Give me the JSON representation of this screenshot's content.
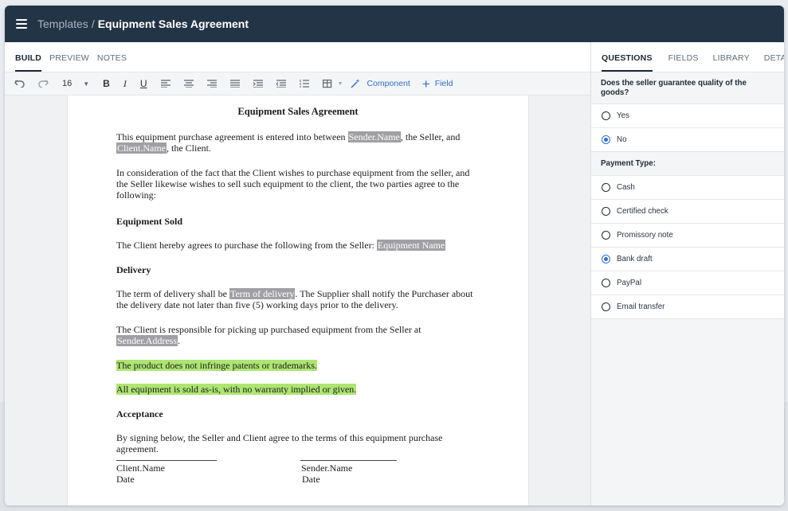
{
  "header": {
    "breadcrumb_parent": "Templates",
    "breadcrumb_separator": "/",
    "title": "Equipment Sales Agreement",
    "menu_icon": "hamburger-icon"
  },
  "editor_tabs": [
    {
      "label": "BUILD",
      "active": true
    },
    {
      "label": "PREVIEW",
      "active": false
    },
    {
      "label": "NOTES",
      "active": false
    }
  ],
  "toolbar": {
    "font_size": "16",
    "icons": [
      "undo-icon",
      "redo-icon",
      "font-size-dropdown",
      "bold-icon",
      "italic-icon",
      "underline-icon",
      "align-left-icon",
      "align-center-icon",
      "align-right-icon",
      "justify-icon",
      "indent-icon",
      "outdent-icon",
      "ordered-list-icon",
      "table-icon",
      "magic-wand-icon"
    ],
    "bold": "B",
    "italic": "I",
    "underline": "U",
    "component_label": "Component",
    "field_label": "Field"
  },
  "document": {
    "title": "Equipment Sales Agreement",
    "p1_before": "This equipment purchase agreement is entered into between ",
    "p1_var1": "Sender.Name",
    "p1_mid": ", the Seller, and",
    "p1_var2": "Client.Name",
    "p1_after": ", the Client.",
    "p2": "In consideration of the fact that the Client wishes to purchase equipment from the seller, and the Seller likewise wishes to sell such equipment to the client, the two parties agree to the following:",
    "h_sold": "Equipment Sold",
    "p3_before": "The Client hereby agrees to purchase the following from the Seller: ",
    "p3_var": "Equipment Name",
    "h_delivery": "Delivery",
    "p4_before": "The term of delivery shall be ",
    "p4_var": "Term of delivery",
    "p4_after": ". The Supplier shall notify the Purchaser about the delivery date not later than five (5) working days prior to the delivery.",
    "p5_before": "The Client is responsible for picking up purchased equipment from the Seller at",
    "p5_var": "Sender.Address",
    "p5_after": ".",
    "hl1": "The product does not infringe patents or trademarks.",
    "hl2": "All equipment is sold as-is, with no warranty implied or given.",
    "h_acceptance": "Acceptance",
    "p6": "By signing below, the Seller and Client agree to the terms of this equipment purchase agreement.",
    "sig_client_name": "Client.Name",
    "sig_client_date": "Date",
    "sig_sender_name": "Sender.Name",
    "sig_sender_date": "Date",
    "colors": {
      "variable_bg": "#a0a0a4",
      "highlight_bg": "#aee572"
    }
  },
  "sidebar_tabs": [
    {
      "label": "QUESTIONS",
      "active": true
    },
    {
      "label": "FIELDS",
      "active": false
    },
    {
      "label": "LIBRARY",
      "active": false
    },
    {
      "label": "DETAILS",
      "active": false
    }
  ],
  "questions": [
    {
      "label": "Does the seller guarantee quality of the goods?",
      "options": [
        {
          "label": "Yes",
          "selected": false
        },
        {
          "label": "No",
          "selected": true
        }
      ]
    },
    {
      "label": "Payment Type:",
      "options": [
        {
          "label": "Cash",
          "selected": false
        },
        {
          "label": "Certified check",
          "selected": false
        },
        {
          "label": "Promissory note",
          "selected": false
        },
        {
          "label": "Bank draft",
          "selected": true
        },
        {
          "label": "PayPal",
          "selected": false
        },
        {
          "label": "Email transfer",
          "selected": false
        }
      ]
    }
  ],
  "colors": {
    "topbar": "#243447",
    "accent": "#2d6fd6"
  }
}
